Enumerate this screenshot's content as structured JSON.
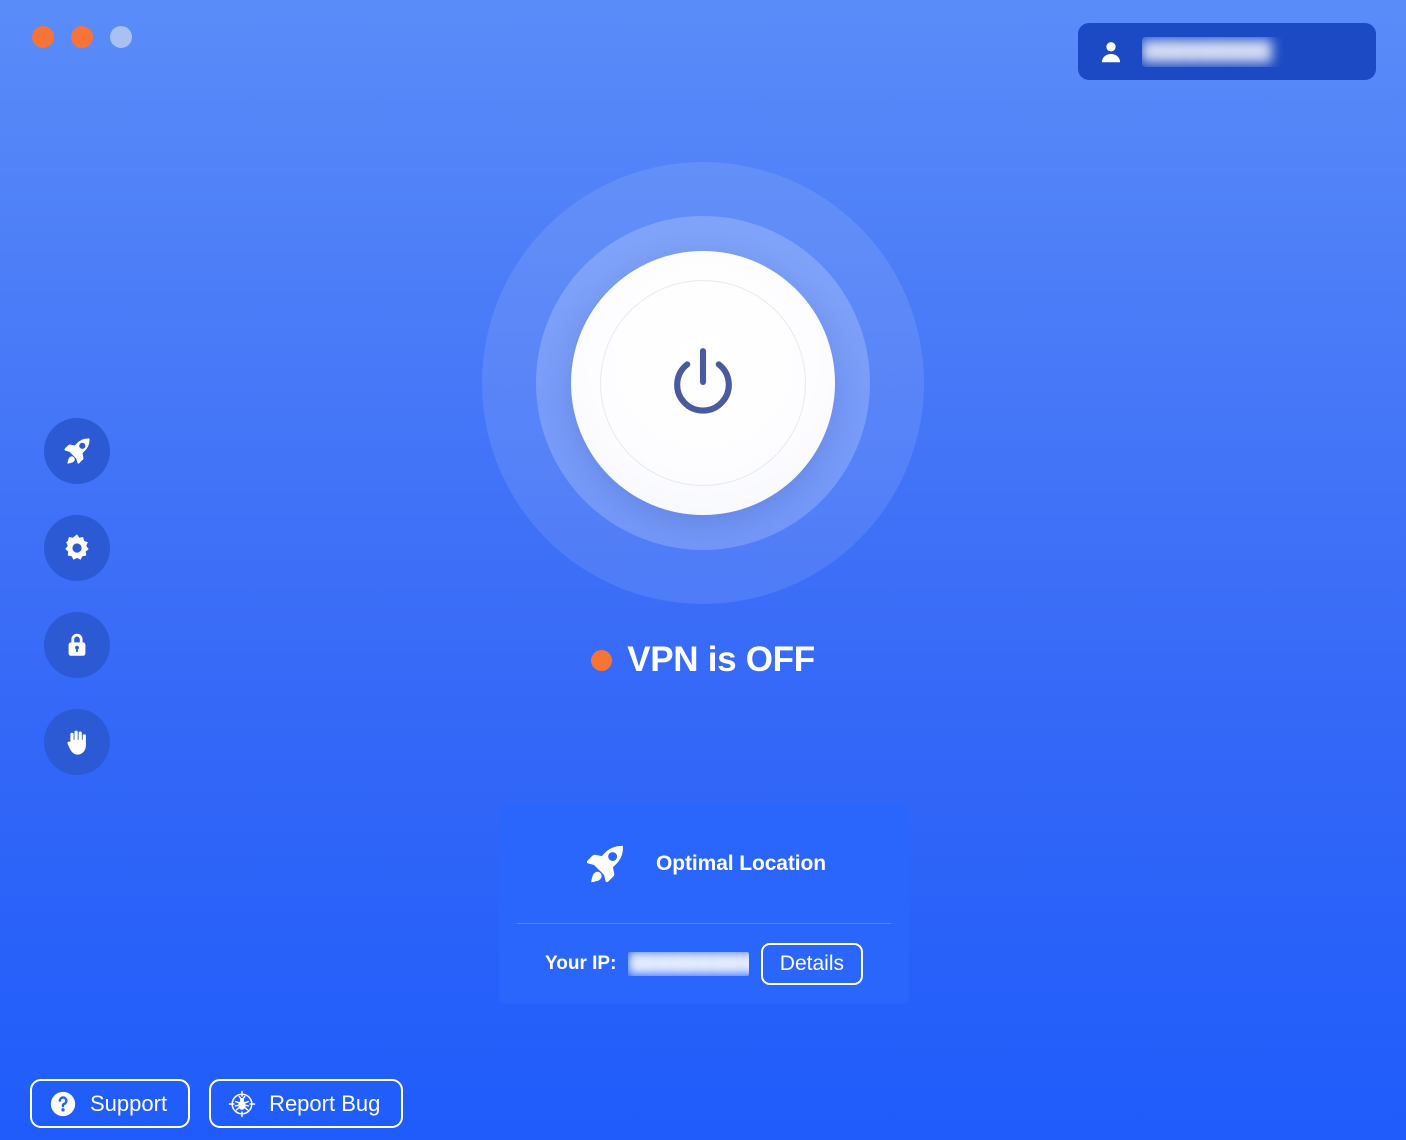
{
  "window": {
    "controls": [
      {
        "name": "close",
        "color": "#f87338"
      },
      {
        "name": "minimize",
        "color": "#f87338"
      },
      {
        "name": "zoom",
        "color": "#a9c0f2"
      }
    ]
  },
  "account": {
    "icon": "person-icon",
    "username_redacted": "█████████",
    "badge_color": "#1c4ac4"
  },
  "sidebar": {
    "items": [
      {
        "icon": "rocket-icon",
        "name": "locations"
      },
      {
        "icon": "gear-icon",
        "name": "settings"
      },
      {
        "icon": "lock-icon",
        "name": "security"
      },
      {
        "icon": "hand-icon",
        "name": "privacy"
      }
    ]
  },
  "power": {
    "icon": "power-icon",
    "glyph_color": "#4a5a9e",
    "state": "off"
  },
  "status": {
    "text": "VPN is OFF",
    "dot_color": "#f97333",
    "connected": false
  },
  "location": {
    "icon": "rocket-icon",
    "name": "Optimal Location",
    "ip_label": "Your IP:",
    "ip_redacted": "██████████",
    "details_label": "Details",
    "card_color": "#2a66fb"
  },
  "footer": {
    "support_label": "Support",
    "support_icon": "question-circle-icon",
    "report_label": "Report Bug",
    "report_icon": "bug-target-icon"
  },
  "theme": {
    "bg_top": "#5a8cf9",
    "bg_bottom": "#1f5cfb",
    "accent_orange": "#f97333",
    "sidebar_circle": "#2c5ad4"
  }
}
